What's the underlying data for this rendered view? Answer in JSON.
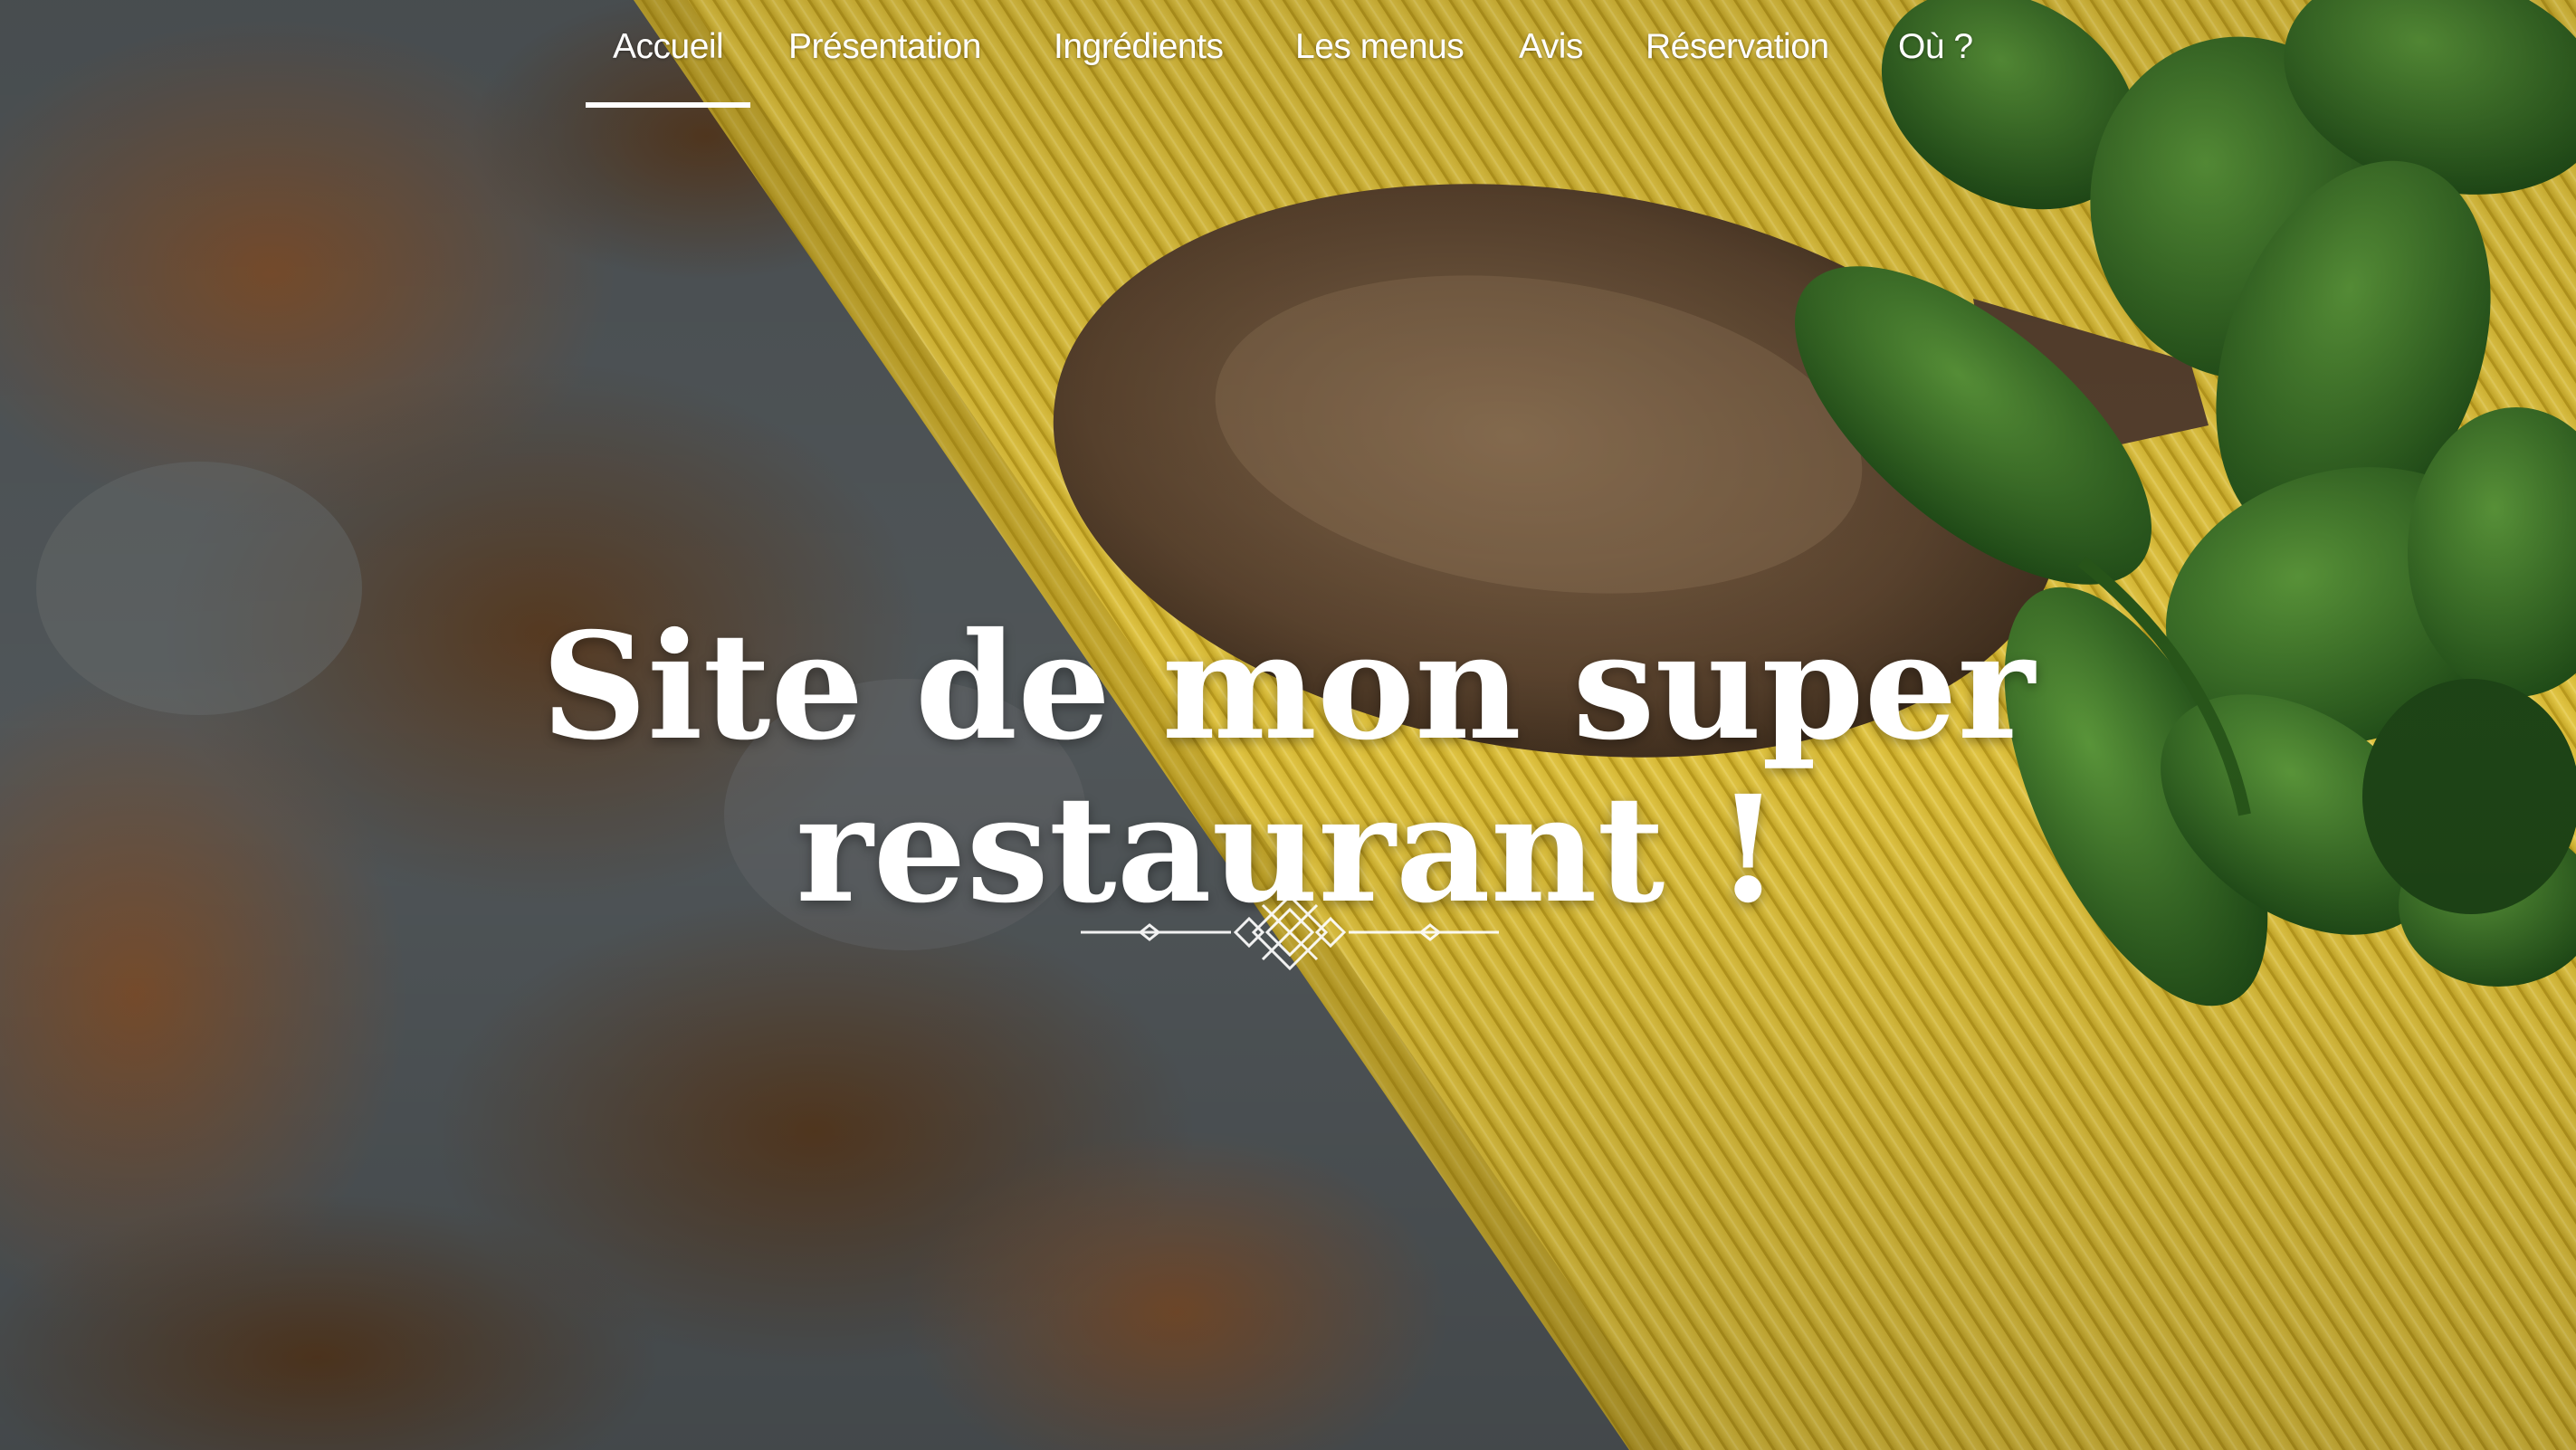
{
  "nav": {
    "items": [
      {
        "label": "Accueil",
        "active": true
      },
      {
        "label": "Présentation"
      },
      {
        "label": "Ingrédients"
      },
      {
        "label": "Les menus"
      },
      {
        "label": "Avis"
      },
      {
        "label": "Réservation"
      },
      {
        "label": "Où ?"
      }
    ]
  },
  "hero": {
    "title_line1": "Site de mon super",
    "title_line2": "restaurant !",
    "background_icon": "pasta-spoon-basil-photo",
    "ornament_icon": "ornamental-divider-icon"
  },
  "colors": {
    "text": "#ffffff",
    "pasta": "#e6c63a",
    "stone": "#4f5255",
    "rust": "#7a4a25",
    "basil": "#2f6b22",
    "spoon": "#6a5036"
  }
}
